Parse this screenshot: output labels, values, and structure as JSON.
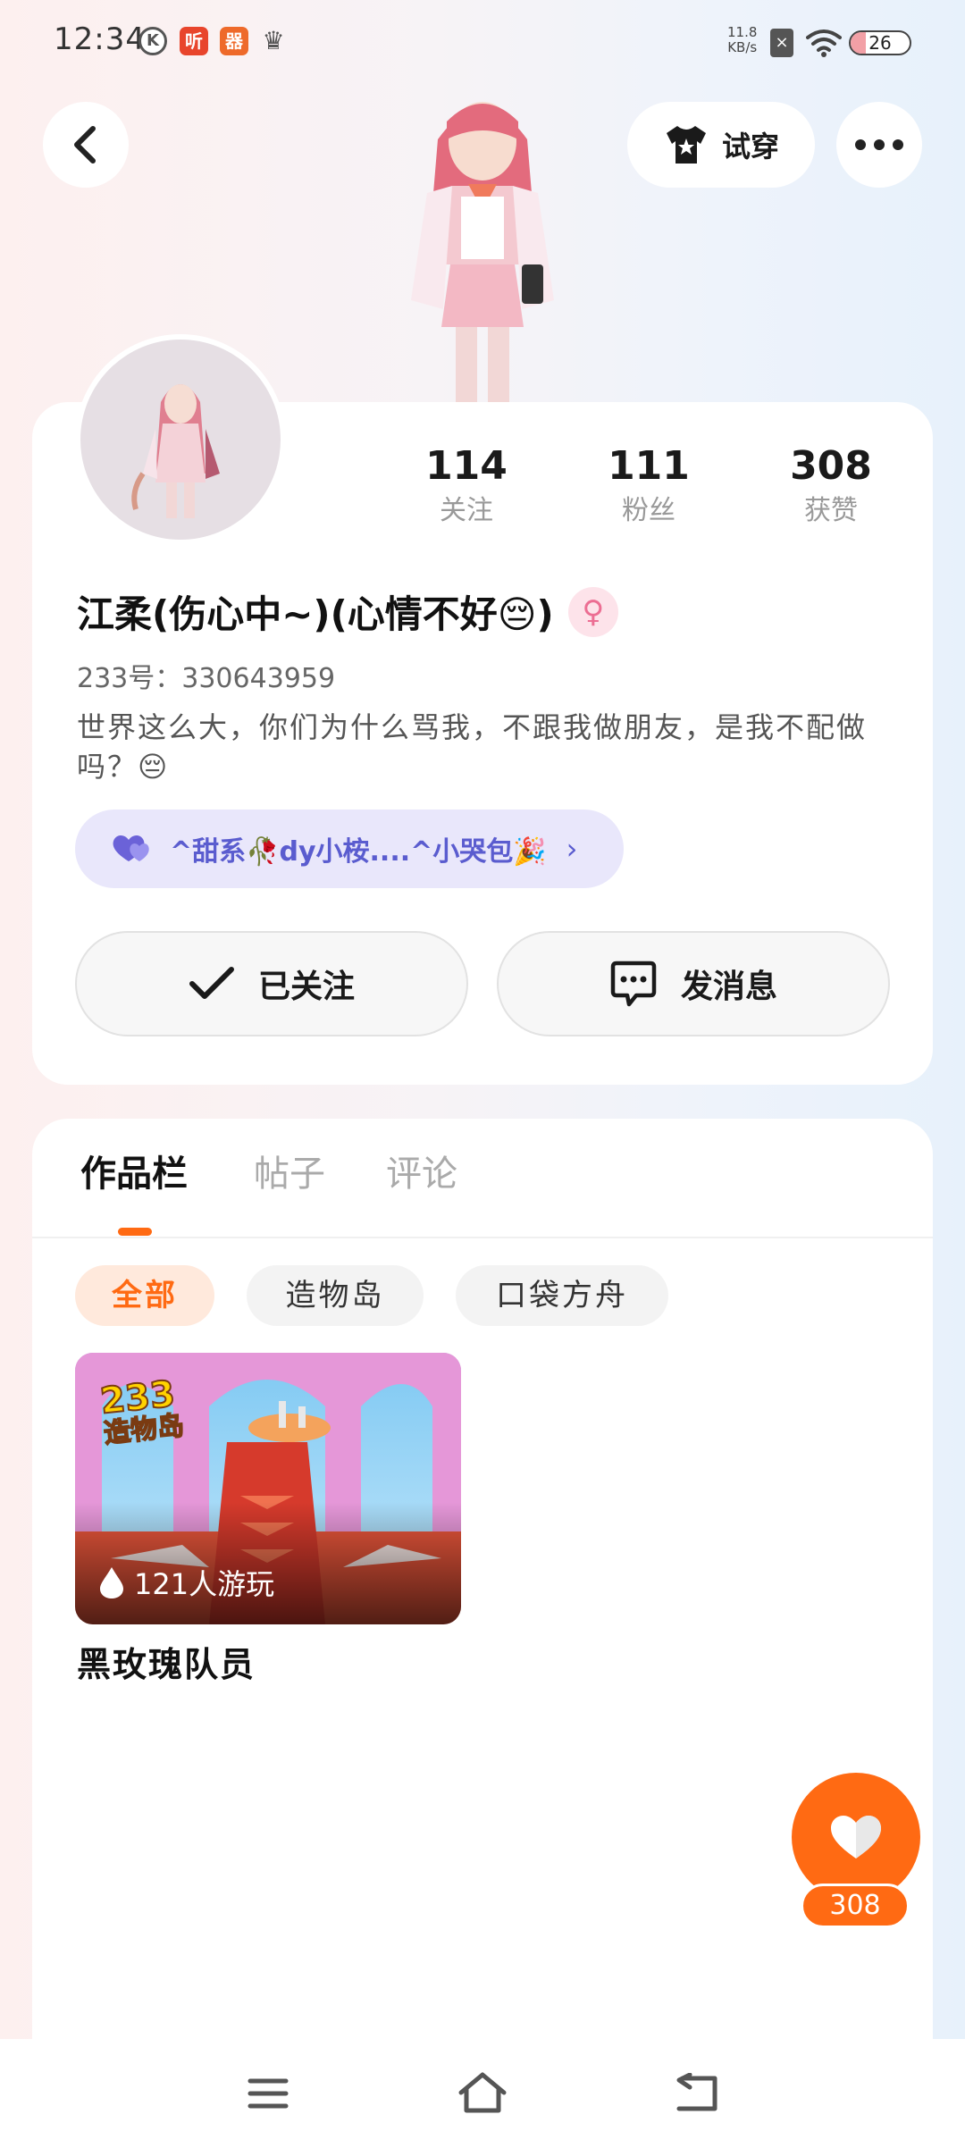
{
  "status_bar": {
    "time": "12:34",
    "app_badges": [
      "K",
      "听",
      "器"
    ],
    "net_speed_value": "11.8",
    "net_speed_unit": "KB/s",
    "battery": "26"
  },
  "header": {
    "tryon_label": "试穿"
  },
  "profile": {
    "stats": [
      {
        "value": "114",
        "label": "关注"
      },
      {
        "value": "111",
        "label": "粉丝"
      },
      {
        "value": "308",
        "label": "获赞"
      }
    ],
    "name": "江柔(伤心中~)(心情不好😔)",
    "gender_symbol": "♀",
    "user_id": "233号：330643959",
    "bio": "世界这么大，你们为什么骂我，不跟我做朋友，是我不配做吗？😔",
    "group_name": "^甜系🥀dy小桉....^小哭包🎉",
    "follow_label": "已关注",
    "message_label": "发消息"
  },
  "works": {
    "tabs": [
      "作品栏",
      "帖子",
      "评论"
    ],
    "filters": [
      "全部",
      "造物岛",
      "口袋方舟"
    ],
    "items": [
      {
        "title": "黑玫瑰队员",
        "play_count": "121人游玩",
        "game_logo_number": "233",
        "game_logo_text": "造物岛"
      }
    ]
  },
  "like_fab": {
    "count": "308"
  },
  "colors": {
    "accent": "#ff6a13",
    "group_pill_bg": "#e9e7fb",
    "group_text": "#5a5ccf"
  },
  "icons": [
    "chevron-left-icon",
    "tshirt-icon",
    "more-dots-icon",
    "heart-icon",
    "check-icon",
    "chat-bubble-icon",
    "drop-icon",
    "menu-icon",
    "home-icon",
    "back-icon"
  ]
}
